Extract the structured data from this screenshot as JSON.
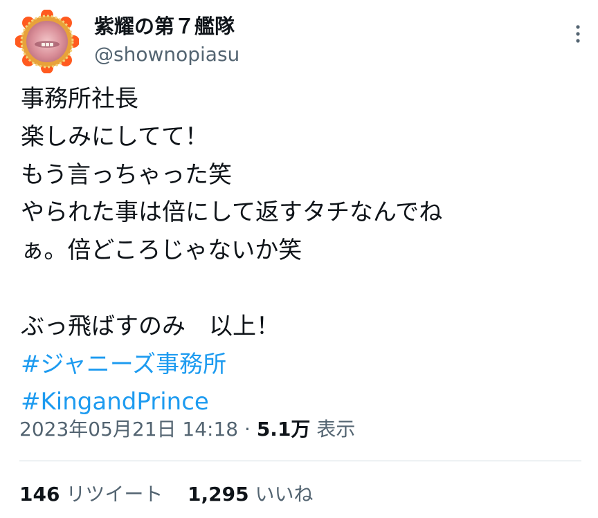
{
  "author": {
    "display_name": "紫耀の第７艦隊",
    "handle": "@shownopiasu",
    "avatar_icon": "avatar-image",
    "avatar_frame_color": "#e8a23a",
    "avatar_petal_color": "#ff5a1f"
  },
  "menu": {
    "more_icon": "more-vertical-icon"
  },
  "tweet": {
    "lines": [
      "事務所社長",
      "楽しみにしてて！",
      "もう言っちゃった笑",
      "やられた事は倍にして返すタチなんでね",
      "ぁ。倍どころじゃないか笑",
      "",
      "ぶっ飛ばすのみ　以上！"
    ],
    "hashtags": [
      "#ジャニーズ事務所",
      "#KingandPrince"
    ],
    "hashtag_color": "#1d9bf0"
  },
  "meta": {
    "timestamp": "2023年05月21日 14:18",
    "separator": "·",
    "views_count": "5.1万",
    "views_label": "表示"
  },
  "stats": {
    "retweets_count": "146",
    "retweets_label": "リツイート",
    "likes_count": "1,295",
    "likes_label": "いいね"
  }
}
